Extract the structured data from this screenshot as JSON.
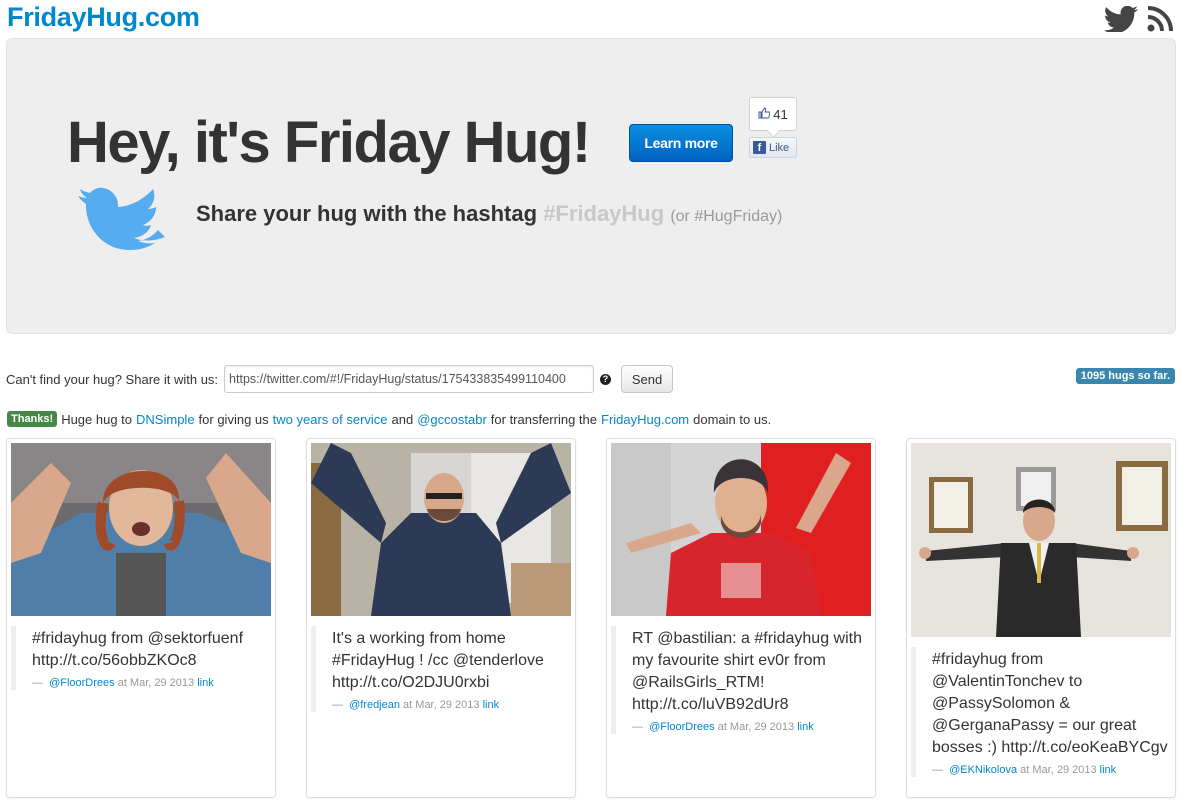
{
  "header": {
    "logo": "FridayHug.com",
    "icons": [
      "twitter-icon",
      "rss-icon"
    ]
  },
  "hero": {
    "title": "Hey, it's Friday Hug!",
    "learn_more": "Learn more",
    "like_count": "41",
    "like_label": "Like",
    "share_text": "Share your hug with the hashtag ",
    "hashtag": "#FridayHug",
    "alt_hashtag": "(or #HugFriday)"
  },
  "submit": {
    "label": "Can't find your hug? Share it with us:",
    "input_value": "https://twitter.com/#!/FridayHug/status/175433835499110400",
    "help": "?",
    "send": "Send"
  },
  "hug_count": "1095 hugs so far.",
  "thanks": {
    "badge": "Thanks!",
    "t1": "Huge hug to",
    "dnsimple": "DNSimple",
    "t2": "for giving us",
    "service": "two years of service",
    "t3": "and",
    "user": "@gccostabr",
    "t4": "for transferring the",
    "domain": "FridayHug.com",
    "t5": "domain to us."
  },
  "cards": [
    {
      "tweet": "#fridayhug from @sektorfuenf http://t.co/56obbZKOc8",
      "user": "@FloorDrees",
      "date": "at Mar, 29 2013",
      "link": "link"
    },
    {
      "tweet": "It's a working from home #FridayHug ! /cc @tenderlove http://t.co/O2DJU0rxbi",
      "user": "@fredjean",
      "date": "at Mar, 29 2013",
      "link": "link"
    },
    {
      "tweet": "RT @bastilian: a #fridayhug with my favourite shirt ev0r from @RailsGirls_RTM! http://t.co/luVB92dUr8",
      "user": "@FloorDrees",
      "date": "at Mar, 29 2013",
      "link": "link"
    },
    {
      "tweet": "#fridayhug from @ValentinTonchev to @PassySolomon & @GerganaPassy = our great bosses :) http://t.co/eoKeaBYCgv",
      "user": "@EKNikolova",
      "date": "at Mar, 29 2013",
      "link": "link"
    }
  ],
  "colors": {
    "brand": "#0088cc",
    "hero_bg": "#eeeeee",
    "badge_info": "#3a87ad",
    "badge_success": "#468847",
    "twitter_blue": "#55acee"
  }
}
